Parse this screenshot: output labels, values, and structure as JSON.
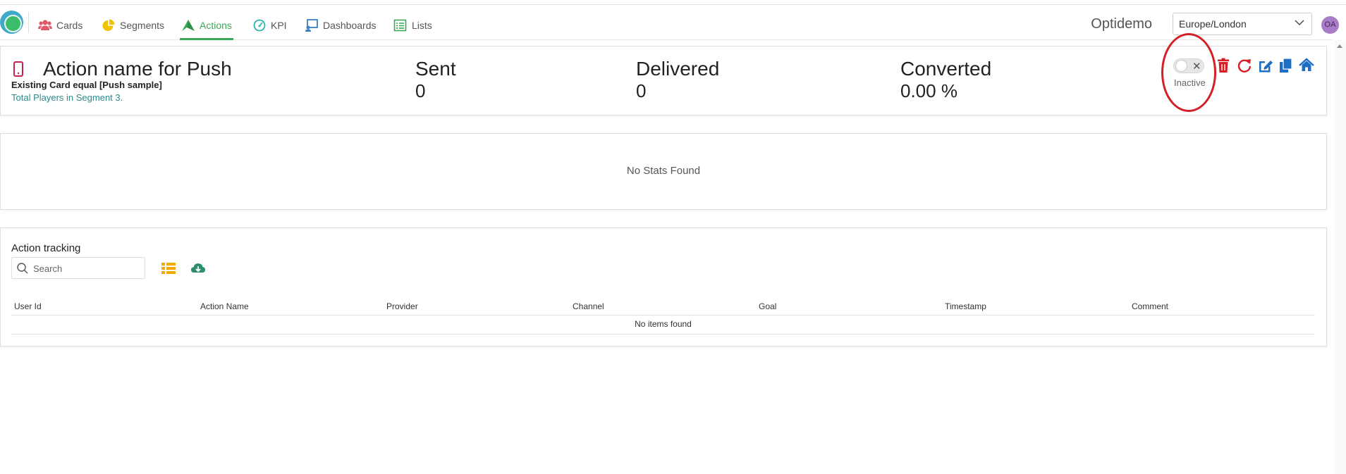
{
  "nav": {
    "items": [
      {
        "label": "Cards",
        "icon": "users-icon",
        "color": "#e05a6a"
      },
      {
        "label": "Segments",
        "icon": "pie-chart-icon",
        "color": "#f2c200"
      },
      {
        "label": "Actions",
        "icon": "send-icon",
        "color": "#3aa856",
        "active": true
      },
      {
        "label": "KPI",
        "icon": "gauge-icon",
        "color": "#2bb3b3"
      },
      {
        "label": "Dashboards",
        "icon": "dashboard-icon",
        "color": "#3a7fc2"
      },
      {
        "label": "Lists",
        "icon": "list-icon",
        "color": "#3aa856"
      }
    ],
    "brand": "Optidemo",
    "timezone": "Europe/London",
    "avatar": "OA"
  },
  "action": {
    "title": "Action name for Push",
    "condition": "Existing Card equal [Push sample]",
    "segment_info": "Total Players in Segment 3.",
    "stats": [
      {
        "label": "Sent",
        "value": "0"
      },
      {
        "label": "Delivered",
        "value": "0"
      },
      {
        "label": "Converted",
        "value": "0.00 %"
      }
    ],
    "toggle_state": "Inactive",
    "toggle_symbol": "✕",
    "toolbar_icons": [
      "trash-icon",
      "refresh-icon",
      "edit-icon",
      "copy-icon",
      "home-icon"
    ]
  },
  "stats_panel": {
    "empty_text": "No Stats Found"
  },
  "tracking": {
    "title": "Action tracking",
    "search_placeholder": "Search",
    "columns": [
      "User Id",
      "Action Name",
      "Provider",
      "Channel",
      "Goal",
      "Timestamp",
      "Comment"
    ],
    "empty_text": "No items found"
  },
  "colors": {
    "accent": "#3aa856",
    "danger": "#d31f26",
    "primary": "#1c6fc2",
    "teal": "#2b8a8a",
    "phone": "#c8254e"
  }
}
